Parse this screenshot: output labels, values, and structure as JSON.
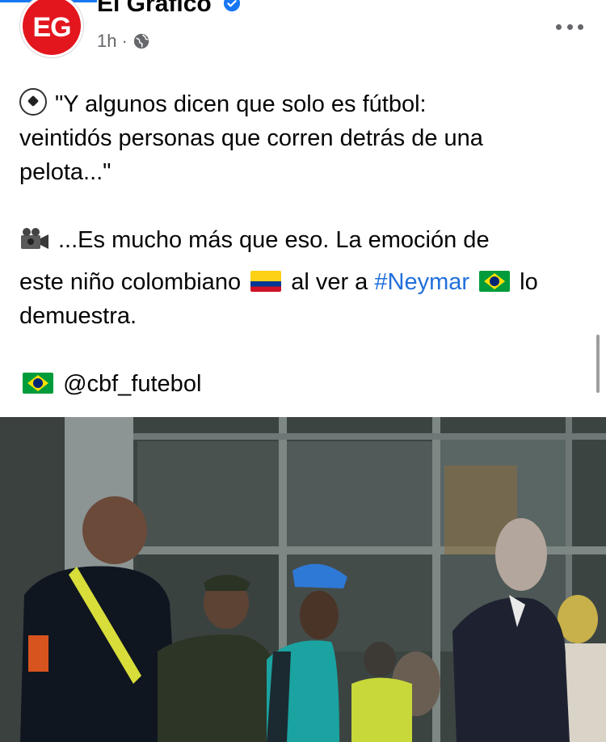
{
  "post": {
    "page_name": "El Grafico",
    "time": "1h",
    "avatar_text": "EG",
    "line1": "\"Y algunos dicen que solo es fútbol:",
    "line2": "veintidós personas que corren detrás de una",
    "line3": "pelota...\"",
    "line4": "...Es mucho más que eso. La emoción de",
    "line5a": "este niño colombiano",
    "line5b": "al ver a",
    "hashtag": "#Neymar",
    "line5c": "lo",
    "line6": "demuestra.",
    "mention": "@cbf_futebol"
  },
  "icons": [
    "verified-badge-icon",
    "globe-icon",
    "more-options-icon",
    "soccer-ball-emoji",
    "video-camera-emoji",
    "colombia-flag-emoji",
    "brazil-flag-emoji"
  ],
  "colors": {
    "link": "#216fdb",
    "verified": "#1877f2",
    "secondary_text": "#65676b",
    "brand_red": "#e3161e"
  }
}
